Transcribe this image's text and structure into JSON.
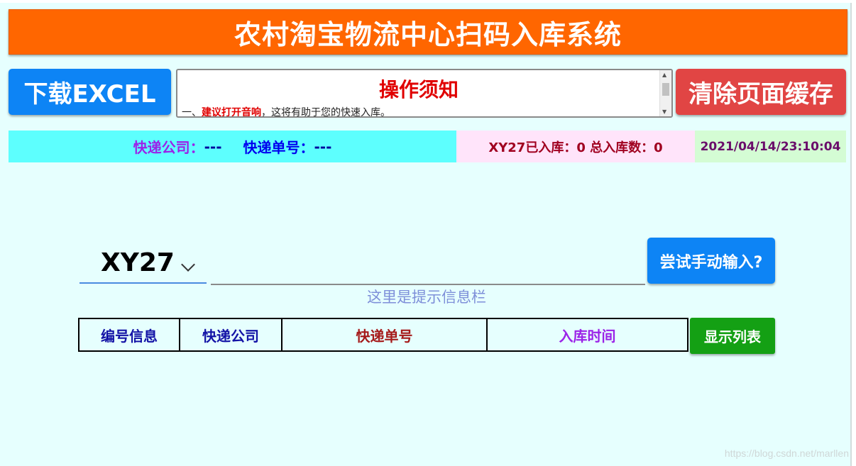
{
  "header": {
    "title": "农村淘宝物流中心扫码入库系统"
  },
  "toolbar": {
    "download_label": "下载EXCEL",
    "clear_label": "清除页面缓存"
  },
  "notice": {
    "title": "操作须知",
    "line_prefix": "一、",
    "line_warn": "建议打开音响",
    "line_rest": "，这将有助于您的快速入库。"
  },
  "status": {
    "company_label": "快递公司：",
    "company_value": "---",
    "tracking_label": "快递单号：",
    "tracking_value": "---",
    "stock_text": "XY27已入库：0 总入库数：0",
    "datetime": "2021/04/14/23:10:04"
  },
  "scan": {
    "station_selected": "XY27",
    "input_value": "",
    "manual_button": "尝试手动输入?",
    "hint": "这里是提示信息栏"
  },
  "table": {
    "headers": [
      "编号信息",
      "快递公司",
      "快递单号",
      "入库时间"
    ],
    "show_list_button": "显示列表"
  },
  "watermark": "https://blog.csdn.net/marllen",
  "colors": {
    "title_bg": "#ff6600",
    "primary_blue": "#0d84f5",
    "danger_red": "#e14544",
    "success_green": "#14a014",
    "page_bg": "#e6fffe"
  }
}
